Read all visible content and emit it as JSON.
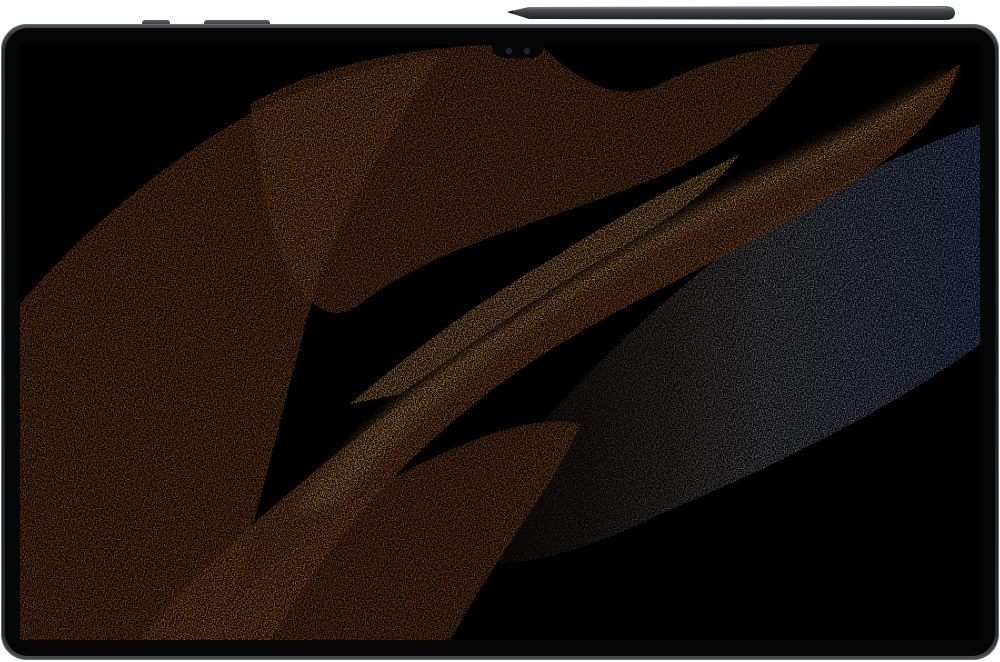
{
  "device": {
    "type": "tablet",
    "accessory": "stylus",
    "colors": {
      "body": "#1c1d20",
      "bezel": "#050505",
      "wallpaper_warm": "#e07a2c",
      "wallpaper_highlight": "#ffb45a",
      "wallpaper_cool": "#7e9be0"
    }
  }
}
